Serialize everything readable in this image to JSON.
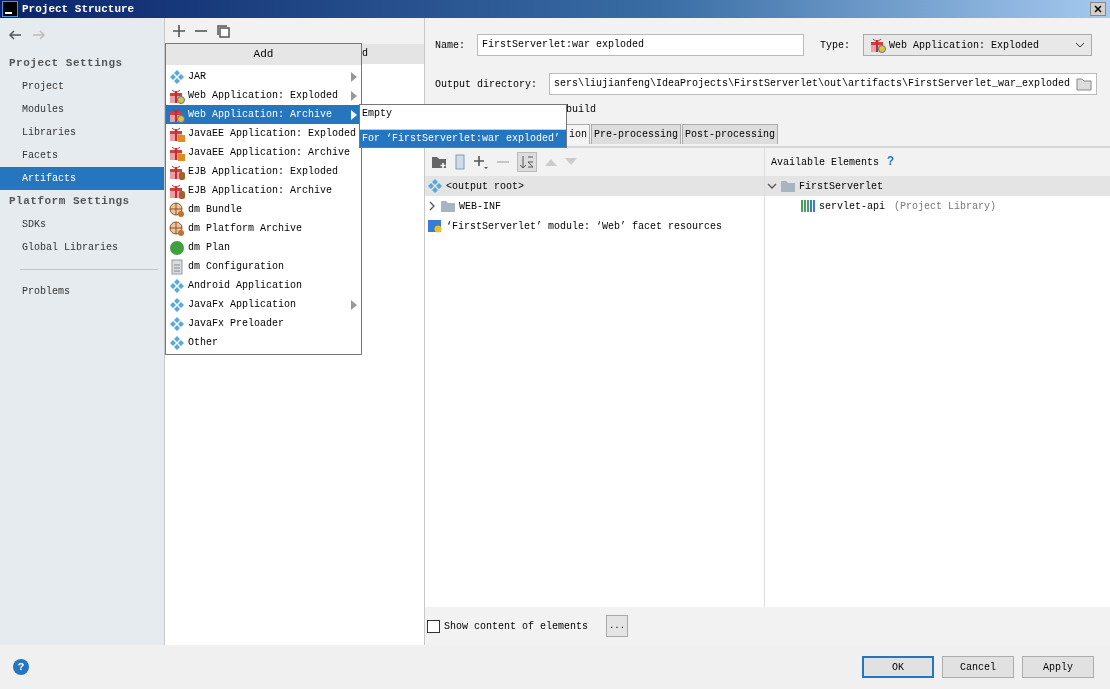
{
  "window": {
    "title": "Project Structure"
  },
  "nav": {
    "back_enabled": true,
    "forward_enabled": false
  },
  "sidebar": {
    "sections": [
      {
        "heading": "Project Settings",
        "items": [
          {
            "label": "Project",
            "selected": false
          },
          {
            "label": "Modules",
            "selected": false
          },
          {
            "label": "Libraries",
            "selected": false
          },
          {
            "label": "Facets",
            "selected": false
          },
          {
            "label": "Artifacts",
            "selected": true
          }
        ]
      },
      {
        "heading": "Platform Settings",
        "items": [
          {
            "label": "SDKs",
            "selected": false
          },
          {
            "label": "Global Libraries",
            "selected": false
          }
        ]
      }
    ],
    "extra_items": [
      {
        "label": "Problems",
        "selected": false
      }
    ]
  },
  "artifacts_list": {
    "row_tail": "d"
  },
  "add_menu": {
    "title": "Add",
    "items": [
      {
        "label": "JAR",
        "kind": "diamonds",
        "submenu": true,
        "selected": false
      },
      {
        "label": "Web Application: Exploded",
        "kind": "web",
        "submenu": true,
        "selected": false
      },
      {
        "label": "Web Application: Archive",
        "kind": "web",
        "submenu": true,
        "selected": true
      },
      {
        "label": "JavaEE Application: Exploded",
        "kind": "javaee",
        "submenu": false,
        "selected": false
      },
      {
        "label": "JavaEE Application: Archive",
        "kind": "javaee",
        "submenu": false,
        "selected": false
      },
      {
        "label": "EJB Application: Exploded",
        "kind": "ejb",
        "submenu": false,
        "selected": false
      },
      {
        "label": "EJB Application: Archive",
        "kind": "ejb",
        "submenu": false,
        "selected": false
      },
      {
        "label": "dm Bundle",
        "kind": "bundle",
        "submenu": false,
        "selected": false
      },
      {
        "label": "dm Platform Archive",
        "kind": "bundle",
        "submenu": false,
        "selected": false
      },
      {
        "label": "dm Plan",
        "kind": "plan",
        "submenu": false,
        "selected": false
      },
      {
        "label": "dm Configuration",
        "kind": "config",
        "submenu": false,
        "selected": false
      },
      {
        "label": "Android Application",
        "kind": "diamonds",
        "submenu": false,
        "selected": false
      },
      {
        "label": "JavaFx Application",
        "kind": "diamonds",
        "submenu": true,
        "selected": false
      },
      {
        "label": "JavaFx Preloader",
        "kind": "diamonds",
        "submenu": false,
        "selected": false
      },
      {
        "label": "Other",
        "kind": "diamonds",
        "submenu": false,
        "selected": false
      }
    ]
  },
  "submenu": {
    "items": [
      {
        "label": "Empty",
        "selected": false
      },
      {
        "label": "For ‘FirstServerlet:war exploded’",
        "selected": true
      }
    ]
  },
  "editor": {
    "name_label": "Name:",
    "name_value": "FirstServerlet:war exploded",
    "type_label": "Type:",
    "type_value": "Web Application: Exploded",
    "output_label": "Output directory:",
    "output_value": "sers\\liujianfeng\\IdeaProjects\\FirstServerlet\\out\\artifacts\\FirstServerlet_war_exploded",
    "build_tail": "build",
    "tabs": [
      {
        "label": "ion",
        "selected": true
      },
      {
        "label": "Pre-processing",
        "selected": false
      },
      {
        "label": "Post-processing",
        "selected": false
      }
    ]
  },
  "layout": {
    "left_tree": [
      {
        "label": "<output root>",
        "kind": "root",
        "selected": true,
        "children": [
          {
            "label": "WEB-INF",
            "kind": "folder",
            "expanded": false,
            "selected": false
          },
          {
            "label": "‘FirstServerlet’ module: ‘Web’ facet resources",
            "kind": "module",
            "selected": false
          }
        ]
      }
    ],
    "available_label": "Available Elements",
    "help": "?",
    "right_tree": [
      {
        "label": "FirstServerlet",
        "kind": "folder",
        "expanded": true,
        "selected": true,
        "children": [
          {
            "label": "servlet-api",
            "note": "(Project Library)",
            "kind": "library",
            "selected": false
          }
        ]
      }
    ]
  },
  "show_content": {
    "label": "Show content of elements",
    "checked": false,
    "button": "..."
  },
  "help_button": "?",
  "buttons": [
    {
      "label": "OK",
      "default": true
    },
    {
      "label": "Cancel",
      "default": false
    },
    {
      "label": "Apply",
      "default": false
    }
  ]
}
